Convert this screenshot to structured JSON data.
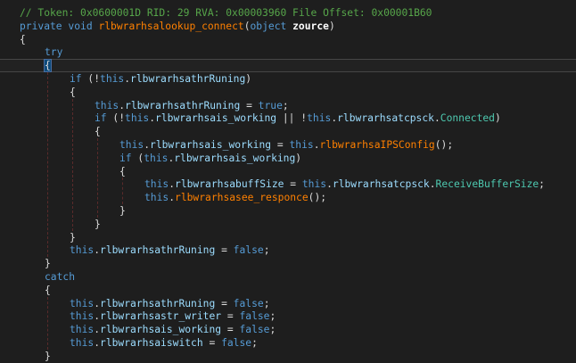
{
  "editor": {
    "lines": [
      {
        "indent": 0,
        "tokens": [
          {
            "t": "// Token: 0x0600001D RID: 29 RVA: 0x00003960 File Offset: 0x00001B60",
            "c": "comment"
          }
        ]
      },
      {
        "indent": 0,
        "tokens": [
          {
            "t": "private",
            "c": "kw"
          },
          {
            "t": " ",
            "c": "plain"
          },
          {
            "t": "void",
            "c": "kw"
          },
          {
            "t": " ",
            "c": "plain"
          },
          {
            "t": "rlbwrarhsalookup_connect",
            "c": "method"
          },
          {
            "t": "(",
            "c": "punct"
          },
          {
            "t": "object",
            "c": "kw"
          },
          {
            "t": " ",
            "c": "plain"
          },
          {
            "t": "zource",
            "c": "param"
          },
          {
            "t": ")",
            "c": "punct"
          }
        ]
      },
      {
        "indent": 0,
        "tokens": [
          {
            "t": "{",
            "c": "punct"
          }
        ]
      },
      {
        "indent": 1,
        "tokens": [
          {
            "t": "try",
            "c": "kw"
          }
        ]
      },
      {
        "indent": 1,
        "tokens": [
          {
            "t": "{",
            "c": "brace-hi"
          }
        ]
      },
      {
        "indent": 2,
        "tokens": [
          {
            "t": "if",
            "c": "kw"
          },
          {
            "t": " (!",
            "c": "punct"
          },
          {
            "t": "this",
            "c": "kw"
          },
          {
            "t": ".",
            "c": "punct"
          },
          {
            "t": "rlbwrarhsathrRuning",
            "c": "member"
          },
          {
            "t": ")",
            "c": "punct"
          }
        ]
      },
      {
        "indent": 2,
        "tokens": [
          {
            "t": "{",
            "c": "punct"
          }
        ]
      },
      {
        "indent": 3,
        "tokens": [
          {
            "t": "this",
            "c": "kw"
          },
          {
            "t": ".",
            "c": "punct"
          },
          {
            "t": "rlbwrarhsathrRuning",
            "c": "member"
          },
          {
            "t": " = ",
            "c": "punct"
          },
          {
            "t": "true",
            "c": "kw"
          },
          {
            "t": ";",
            "c": "punct"
          }
        ]
      },
      {
        "indent": 3,
        "tokens": [
          {
            "t": "if",
            "c": "kw"
          },
          {
            "t": " (!",
            "c": "punct"
          },
          {
            "t": "this",
            "c": "kw"
          },
          {
            "t": ".",
            "c": "punct"
          },
          {
            "t": "rlbwrarhsais_working",
            "c": "member"
          },
          {
            "t": " || !",
            "c": "punct"
          },
          {
            "t": "this",
            "c": "kw"
          },
          {
            "t": ".",
            "c": "punct"
          },
          {
            "t": "rlbwrarhsatcpsck",
            "c": "member"
          },
          {
            "t": ".",
            "c": "punct"
          },
          {
            "t": "Connected",
            "c": "prop"
          },
          {
            "t": ")",
            "c": "punct"
          }
        ]
      },
      {
        "indent": 3,
        "tokens": [
          {
            "t": "{",
            "c": "punct"
          }
        ]
      },
      {
        "indent": 4,
        "tokens": [
          {
            "t": "this",
            "c": "kw"
          },
          {
            "t": ".",
            "c": "punct"
          },
          {
            "t": "rlbwrarhsais_working",
            "c": "member"
          },
          {
            "t": " = ",
            "c": "punct"
          },
          {
            "t": "this",
            "c": "kw"
          },
          {
            "t": ".",
            "c": "punct"
          },
          {
            "t": "rlbwrarhsaIPSConfig",
            "c": "method"
          },
          {
            "t": "();",
            "c": "punct"
          }
        ]
      },
      {
        "indent": 4,
        "tokens": [
          {
            "t": "if",
            "c": "kw"
          },
          {
            "t": " (",
            "c": "punct"
          },
          {
            "t": "this",
            "c": "kw"
          },
          {
            "t": ".",
            "c": "punct"
          },
          {
            "t": "rlbwrarhsais_working",
            "c": "member"
          },
          {
            "t": ")",
            "c": "punct"
          }
        ]
      },
      {
        "indent": 4,
        "tokens": [
          {
            "t": "{",
            "c": "punct"
          }
        ]
      },
      {
        "indent": 5,
        "tokens": [
          {
            "t": "this",
            "c": "kw"
          },
          {
            "t": ".",
            "c": "punct"
          },
          {
            "t": "rlbwrarhsabuffSize",
            "c": "member"
          },
          {
            "t": " = ",
            "c": "punct"
          },
          {
            "t": "this",
            "c": "kw"
          },
          {
            "t": ".",
            "c": "punct"
          },
          {
            "t": "rlbwrarhsatcpsck",
            "c": "member"
          },
          {
            "t": ".",
            "c": "punct"
          },
          {
            "t": "ReceiveBufferSize",
            "c": "prop"
          },
          {
            "t": ";",
            "c": "punct"
          }
        ]
      },
      {
        "indent": 5,
        "tokens": [
          {
            "t": "this",
            "c": "kw"
          },
          {
            "t": ".",
            "c": "punct"
          },
          {
            "t": "rlbwrarhsasee_responce",
            "c": "method"
          },
          {
            "t": "();",
            "c": "punct"
          }
        ]
      },
      {
        "indent": 4,
        "tokens": [
          {
            "t": "}",
            "c": "punct"
          }
        ]
      },
      {
        "indent": 3,
        "tokens": [
          {
            "t": "}",
            "c": "punct"
          }
        ]
      },
      {
        "indent": 2,
        "tokens": [
          {
            "t": "}",
            "c": "punct"
          }
        ]
      },
      {
        "indent": 2,
        "tokens": [
          {
            "t": "this",
            "c": "kw"
          },
          {
            "t": ".",
            "c": "punct"
          },
          {
            "t": "rlbwrarhsathrRuning",
            "c": "member"
          },
          {
            "t": " = ",
            "c": "punct"
          },
          {
            "t": "false",
            "c": "kw"
          },
          {
            "t": ";",
            "c": "punct"
          }
        ]
      },
      {
        "indent": 1,
        "tokens": [
          {
            "t": "}",
            "c": "punct"
          }
        ]
      },
      {
        "indent": 1,
        "tokens": [
          {
            "t": "catch",
            "c": "kw"
          }
        ]
      },
      {
        "indent": 1,
        "tokens": [
          {
            "t": "{",
            "c": "punct"
          }
        ]
      },
      {
        "indent": 2,
        "tokens": [
          {
            "t": "this",
            "c": "kw"
          },
          {
            "t": ".",
            "c": "punct"
          },
          {
            "t": "rlbwrarhsathrRuning",
            "c": "member"
          },
          {
            "t": " = ",
            "c": "punct"
          },
          {
            "t": "false",
            "c": "kw"
          },
          {
            "t": ";",
            "c": "punct"
          }
        ]
      },
      {
        "indent": 2,
        "tokens": [
          {
            "t": "this",
            "c": "kw"
          },
          {
            "t": ".",
            "c": "punct"
          },
          {
            "t": "rlbwrarhsastr_writer",
            "c": "member"
          },
          {
            "t": " = ",
            "c": "punct"
          },
          {
            "t": "false",
            "c": "kw"
          },
          {
            "t": ";",
            "c": "punct"
          }
        ]
      },
      {
        "indent": 2,
        "tokens": [
          {
            "t": "this",
            "c": "kw"
          },
          {
            "t": ".",
            "c": "punct"
          },
          {
            "t": "rlbwrarhsais_working",
            "c": "member"
          },
          {
            "t": " = ",
            "c": "punct"
          },
          {
            "t": "false",
            "c": "kw"
          },
          {
            "t": ";",
            "c": "punct"
          }
        ]
      },
      {
        "indent": 2,
        "tokens": [
          {
            "t": "this",
            "c": "kw"
          },
          {
            "t": ".",
            "c": "punct"
          },
          {
            "t": "rlbwrarhsaiswitch",
            "c": "member"
          },
          {
            "t": " = ",
            "c": "punct"
          },
          {
            "t": "false",
            "c": "kw"
          },
          {
            "t": ";",
            "c": "punct"
          }
        ]
      },
      {
        "indent": 1,
        "tokens": [
          {
            "t": "}",
            "c": "punct"
          }
        ]
      }
    ]
  },
  "colors": {
    "background": "#1e1e1e",
    "comment": "#57a64a",
    "keyword": "#569cd6",
    "method": "#ff8000",
    "property": "#4ec9b0",
    "member": "#9cdcfe",
    "text": "#dcdcdc",
    "guide": "#5a2a2a"
  }
}
